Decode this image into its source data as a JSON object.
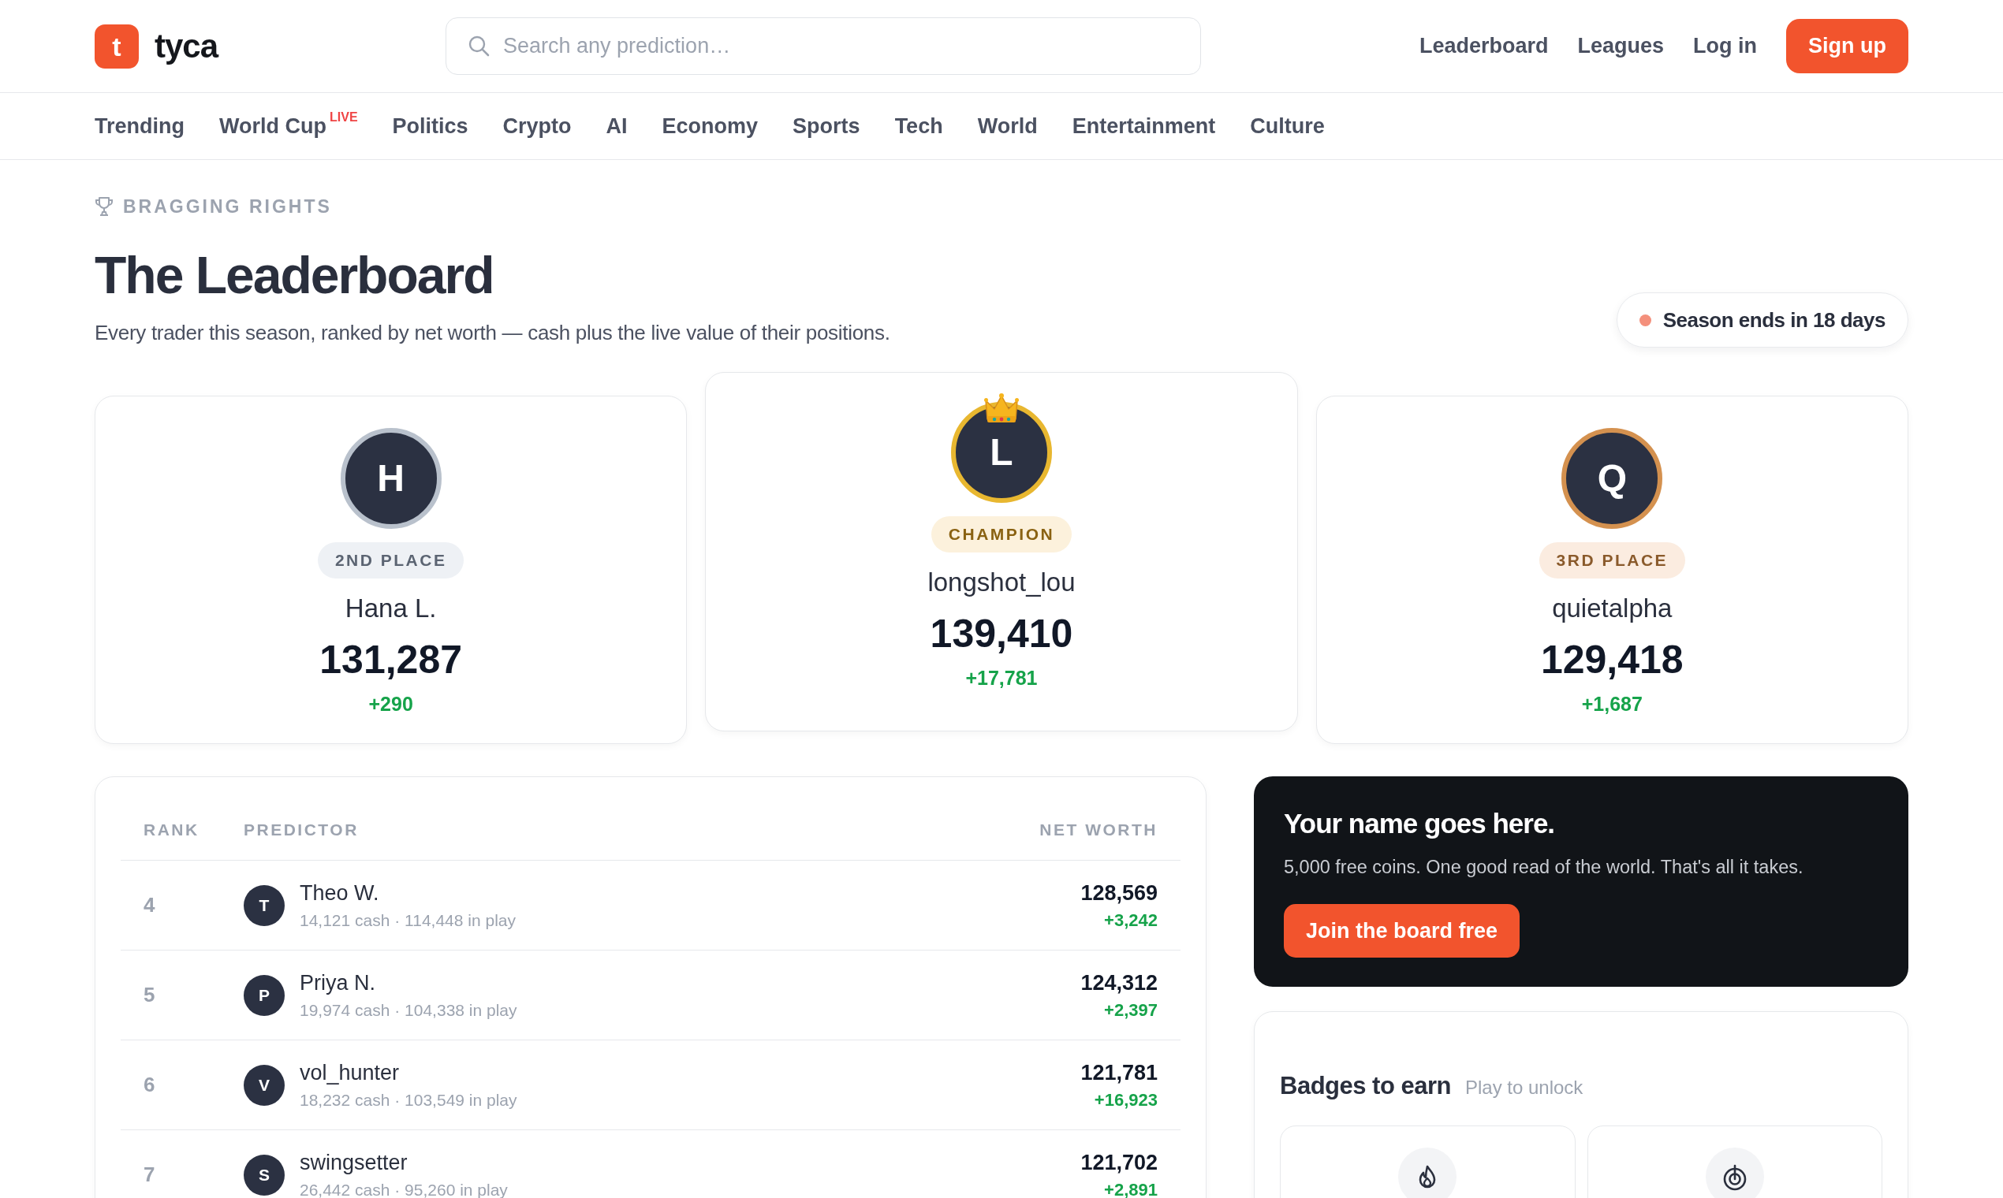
{
  "header": {
    "logo": {
      "mark": "t",
      "name": "tyca"
    },
    "search": {
      "placeholder": "Search any prediction…"
    },
    "nav": [
      {
        "label": "Leaderboard",
        "kind": "link"
      },
      {
        "label": "Leagues",
        "kind": "link"
      },
      {
        "label": "Log in",
        "kind": "link"
      },
      {
        "label": "Sign up",
        "kind": "button"
      }
    ]
  },
  "categories": [
    {
      "label": "Trending"
    },
    {
      "label": "World Cup",
      "tag": "LIVE"
    },
    {
      "label": "Politics"
    },
    {
      "label": "Crypto"
    },
    {
      "label": "AI"
    },
    {
      "label": "Economy"
    },
    {
      "label": "Sports"
    },
    {
      "label": "Tech"
    },
    {
      "label": "World"
    },
    {
      "label": "Entertainment"
    },
    {
      "label": "Culture"
    }
  ],
  "hero": {
    "eyebrow": "BRAGGING RIGHTS",
    "title": "The Leaderboard",
    "subtitle": "Every trader this season, ranked by net worth — cash plus the live value of their positions.",
    "season": "Season ends in 18 days"
  },
  "podium": [
    {
      "kind": "second",
      "initial": "H",
      "label": "2ND PLACE",
      "name": "Hana L.",
      "net_worth": "131,287",
      "change": "+290"
    },
    {
      "kind": "first",
      "initial": "L",
      "label": "CHAMPION",
      "name": "longshot_lou",
      "net_worth": "139,410",
      "change": "+17,781"
    },
    {
      "kind": "third",
      "initial": "Q",
      "label": "3RD PLACE",
      "name": "quietalpha",
      "net_worth": "129,418",
      "change": "+1,687"
    }
  ],
  "table": {
    "columns": [
      "RANK",
      "PREDICTOR",
      "NET WORTH"
    ],
    "rows": [
      {
        "rank": "4",
        "initial": "T",
        "name": "Theo W.",
        "detail": "14,121 cash · 114,448 in play",
        "net_worth": "128,569",
        "change": "+3,242"
      },
      {
        "rank": "5",
        "initial": "P",
        "name": "Priya N.",
        "detail": "19,974 cash · 104,338 in play",
        "net_worth": "124,312",
        "change": "+2,397"
      },
      {
        "rank": "6",
        "initial": "V",
        "name": "vol_hunter",
        "detail": "18,232 cash · 103,549 in play",
        "net_worth": "121,781",
        "change": "+16,923"
      },
      {
        "rank": "7",
        "initial": "S",
        "name": "swingsetter",
        "detail": "26,442 cash · 95,260 in play",
        "net_worth": "121,702",
        "change": "+2,891"
      }
    ]
  },
  "promo": {
    "title": "Your name goes here.",
    "text": "5,000 free coins. One good read of the world. That's all it takes.",
    "button": "Join the board free"
  },
  "badges": {
    "title": "Badges to earn",
    "hint": "Play to unlock",
    "items": [
      {
        "kind": "flame"
      },
      {
        "kind": "target"
      }
    ]
  }
}
